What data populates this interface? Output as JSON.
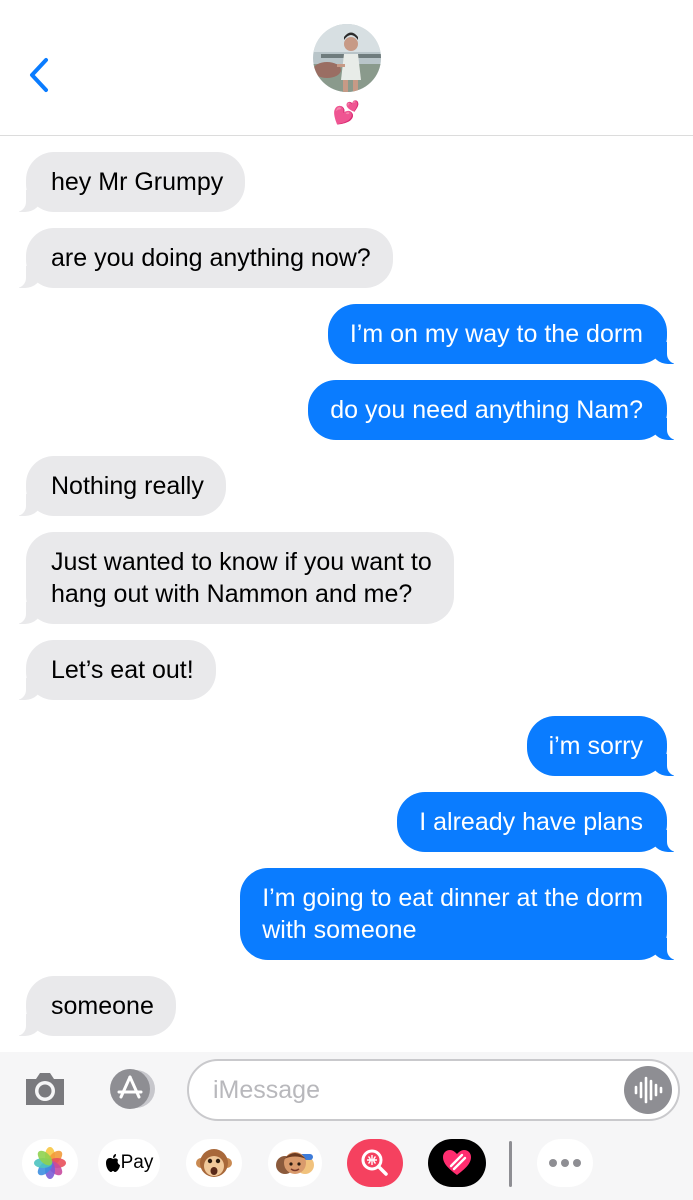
{
  "header": {
    "back_icon": "chevron-left-icon",
    "contact_name": "💕",
    "accent_color": "#0a7cff",
    "avatar_icon": "contact-avatar-photo"
  },
  "messages": [
    {
      "direction": "received",
      "text": "hey Mr Grumpy"
    },
    {
      "direction": "received",
      "text": "are you doing anything now?"
    },
    {
      "direction": "sent",
      "text": "I’m on my way to the dorm"
    },
    {
      "direction": "sent",
      "text": "do you need anything Nam?"
    },
    {
      "direction": "received",
      "text": "Nothing really"
    },
    {
      "direction": "received",
      "text": "Just wanted to know if you want to\nhang out with Nammon and me?"
    },
    {
      "direction": "received",
      "text": "Let’s eat out!"
    },
    {
      "direction": "sent",
      "text": "i’m sorry"
    },
    {
      "direction": "sent",
      "text": "I already have plans"
    },
    {
      "direction": "sent",
      "text": "I’m going to eat dinner at the dorm\nwith someone"
    },
    {
      "direction": "received",
      "text": "someone"
    }
  ],
  "colors": {
    "sent_bubble": "#0a7cff",
    "received_bubble": "#e9e9eb"
  },
  "input_bar": {
    "placeholder": "iMessage",
    "value": "",
    "camera_icon": "camera-icon",
    "apps_icon": "app-store-icon",
    "audio_icon": "audio-waveform-icon"
  },
  "app_drawer": {
    "apps": [
      {
        "icon": "photos-icon"
      },
      {
        "icon": "apple-pay-icon",
        "label": "Pay"
      },
      {
        "icon": "animoji-monkey-icon"
      },
      {
        "icon": "memoji-stickers-icon"
      },
      {
        "icon": "image-search-icon"
      },
      {
        "icon": "digital-touch-heart-icon"
      },
      {
        "icon": "more-icon"
      }
    ]
  }
}
